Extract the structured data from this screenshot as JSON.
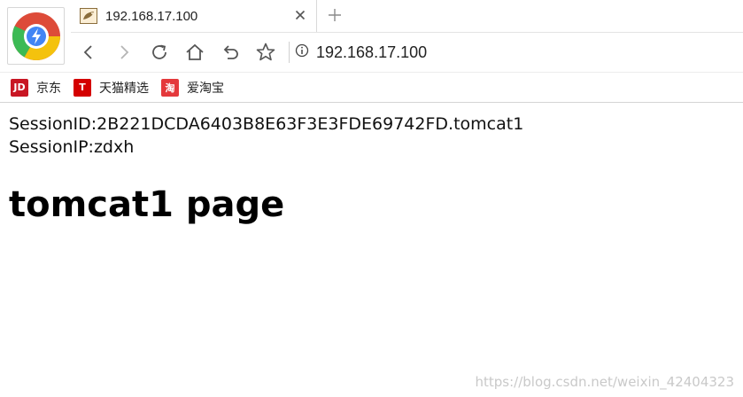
{
  "tab": {
    "title": "192.168.17.100"
  },
  "toolbar": {
    "address": "192.168.17.100"
  },
  "bookmarks": [
    {
      "icon_text": "JD",
      "label": "京东",
      "color": "#c81623"
    },
    {
      "icon_text": "T",
      "label": "天猫精选",
      "color": "#d40000"
    },
    {
      "icon_text": "淘",
      "label": "爱淘宝",
      "color": "#e4393c"
    }
  ],
  "page": {
    "session_id_line": "SessionID:2B221DCDA6403B8E63F3E3FDE69742FD.tomcat1",
    "session_ip_line": "SessionIP:zdxh",
    "heading": "tomcat1 page"
  },
  "watermark": "https://blog.csdn.net/weixin_42404323",
  "icons": {
    "browser_logo": "browser-logo-icon",
    "favicon": "tomcat-favicon-icon",
    "close": "close-icon",
    "new_tab": "plus-icon",
    "back": "back-icon",
    "forward": "forward-icon",
    "reload": "reload-icon",
    "home": "home-icon",
    "undo": "undo-icon",
    "bookmark": "star-icon",
    "info": "info-icon"
  }
}
